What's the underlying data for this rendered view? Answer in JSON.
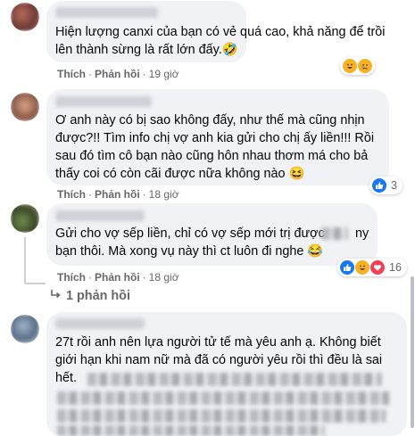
{
  "comments": [
    {
      "lines": [
        "Hiện lượng canxi của bạn có vẻ quá cao, khả năng để trồi",
        "lên thành sừng là rất lớn đấy.🤣"
      ],
      "actions": {
        "like": "Thích",
        "reply": "Phản hồi",
        "time": "19 giờ"
      },
      "reactions": {
        "icons": [
          "haha",
          "sad"
        ],
        "count": ""
      }
    },
    {
      "lines": [
        "Ơ anh này có bị sao không đấy, như thế mà cũng nhịn",
        "được?!! Tìm info chị vợ anh kia gửi cho chị ấy liền!!! Rồi",
        "sau đó tìm cô bạn nào cũng hôn nhau thơm má cho bả",
        "thấy coi có còn cãi được nữa không nào 😆"
      ],
      "actions": {
        "like": "Thích",
        "reply": "Phản hồi",
        "time": "18 giờ"
      },
      "reactions": {
        "icons": [
          "like"
        ],
        "count": "3"
      }
    },
    {
      "lines": [
        "Gửi cho vợ sếp liền, chỉ có vợ sếp mới trị được",
        "ny",
        "bạn thôi. Mà xong vụ này thì ct luôn đi nghe 😂"
      ],
      "actions": {
        "like": "Thích",
        "reply": "Phản hồi",
        "time": "18 giờ"
      },
      "reactions": {
        "icons": [
          "like",
          "haha",
          "love"
        ],
        "count": "16"
      },
      "replies_label": "1 phản hồi"
    },
    {
      "lines": [
        "27t rồi anh nên lựa người tử tế mà yêu anh ạ. Không biết",
        "giới hạn khi nam nữ mà đã có người yêu rồi thì đều là sai",
        "hết."
      ]
    }
  ],
  "colors": {
    "bubble": "#f0f2f5",
    "text": "#050505",
    "meta": "#65676b",
    "like": "#1877f2",
    "love": "#f33e58",
    "haha": "#f7b125"
  }
}
